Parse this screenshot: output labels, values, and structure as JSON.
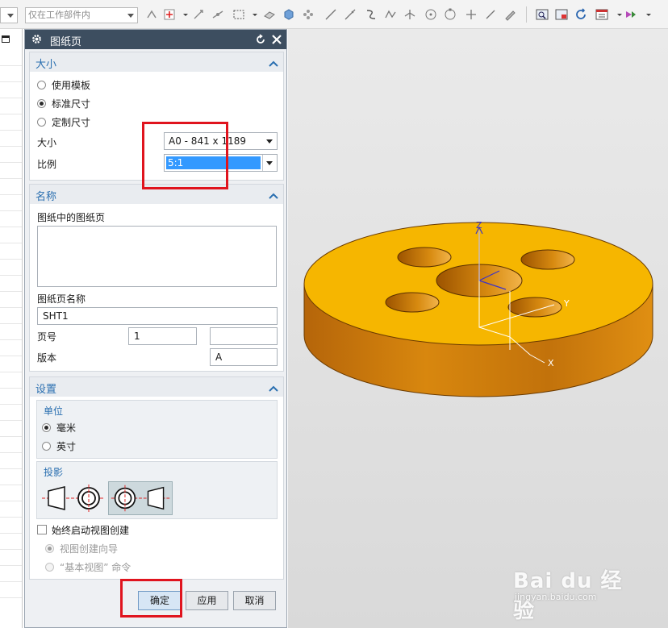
{
  "toolbar": {
    "combo_left_value": "",
    "selection_filter": "仅在工作部件内"
  },
  "dialog": {
    "title": "图纸页",
    "size_group": {
      "title": "大小",
      "option_template": "使用模板",
      "option_standard": "标准尺寸",
      "option_custom": "定制尺寸",
      "size_label": "大小",
      "size_value": "A0 - 841 x 1189",
      "scale_label": "比例",
      "scale_value": "5:1"
    },
    "name_group": {
      "title": "名称",
      "sheets_label": "图纸中的图纸页",
      "sheet_name_label": "图纸页名称",
      "sheet_name_value": "SHT1",
      "page_label": "页号",
      "page_value": "1",
      "page_extra_value": "",
      "revision_label": "版本",
      "revision_value": "A"
    },
    "settings_group": {
      "title": "设置",
      "units_title": "单位",
      "unit_mm": "毫米",
      "unit_inch": "英寸",
      "projection_title": "投影",
      "always_start_view": "始终启动视图创建",
      "view_wizard": "视图创建向导",
      "base_view_cmd": "“基本视图” 命令"
    },
    "buttons": {
      "ok": "确定",
      "apply": "应用",
      "cancel": "取消"
    }
  },
  "viewport": {
    "axis_x": "X",
    "axis_y": "Y",
    "axis_z": "Z",
    "part_color": "#f6b600"
  },
  "watermark": {
    "brand": "Bai du 经验",
    "url": "jingyan.baidu.com"
  },
  "accent_colors": {
    "title_bar": "#3d4e60",
    "highlight": "#3399ff",
    "annotation_red": "#e0141e",
    "group_title": "#2a6fb0"
  }
}
